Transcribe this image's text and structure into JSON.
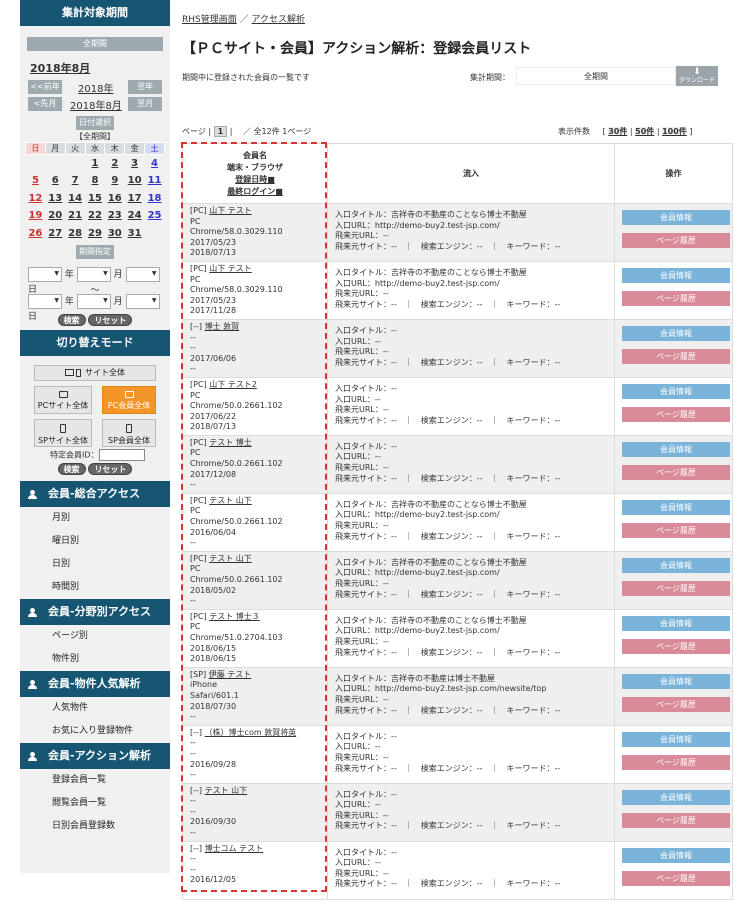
{
  "sidebar": {
    "period_title": "集計対象期間",
    "all_period": "全期間",
    "year_month": "2018年8月",
    "prev_year": "<<前年",
    "year": "2018年",
    "next_year": "翌年",
    "prev_month": "<先月",
    "month": "2018年8月",
    "next_month": "翌月",
    "date_select": "日付選択",
    "all_period_note": "【全期間】",
    "weekdays": [
      "日",
      "月",
      "火",
      "水",
      "木",
      "金",
      "土"
    ],
    "weeks": [
      [
        "",
        "",
        "",
        "1",
        "2",
        "3",
        "4"
      ],
      [
        "5",
        "6",
        "7",
        "8",
        "9",
        "10",
        "11"
      ],
      [
        "12",
        "13",
        "14",
        "15",
        "16",
        "17",
        "18"
      ],
      [
        "19",
        "20",
        "21",
        "22",
        "23",
        "24",
        "25"
      ],
      [
        "26",
        "27",
        "28",
        "29",
        "30",
        "31",
        ""
      ]
    ],
    "range_title": "期間指定",
    "year_label": "年",
    "month_label": "月",
    "day_label": "日",
    "tilde": "～",
    "search": "検索",
    "reset": "リセット",
    "mode_title": "切り替えモード",
    "site_all": "サイト全体",
    "pc_site_all": "PCサイト全体",
    "pc_member_all": "PC会員全体",
    "sp_site_all": "SPサイト全体",
    "sp_member_all": "SP会員全体",
    "member_id_label": "特定会員ID：",
    "categories": [
      {
        "title": "会員-総合アクセス",
        "items": [
          "月別",
          "曜日別",
          "日別",
          "時間別"
        ]
      },
      {
        "title": "会員-分野別アクセス",
        "items": [
          "ページ別",
          "物件別"
        ]
      },
      {
        "title": "会員-物件人気解析",
        "items": [
          "人気物件",
          "お気に入り登録物件"
        ]
      },
      {
        "title": "会員-アクション解析",
        "items": [
          "登録会員一覧",
          "閲覧会員一覧",
          "日別会員登録数"
        ]
      }
    ]
  },
  "header": {
    "breadcrumb_home": "RHS管理画面",
    "breadcrumb_sep": "／",
    "breadcrumb_current": "アクセス解析",
    "title": "【ＰＣサイト・会員】アクション解析：登録会員リスト",
    "description": "期間中に登録された会員の一覧です",
    "period_label": "集計期間：",
    "period_value": "全期間",
    "download": "ダウンロード"
  },
  "pager": {
    "page_label": "ページ",
    "sep": "|",
    "current": "1",
    "slash": "／",
    "total": "全12件 1ページ",
    "per_page_label": "表示件数",
    "bracket_open": "[",
    "bracket_close": "]",
    "opt30": "30件",
    "opt50": "50件",
    "opt100": "100件"
  },
  "table": {
    "col_member": [
      "会員名",
      "端末・ブラウザ"
    ],
    "col_member_links": [
      "登録日時■",
      "最終ログイン■"
    ],
    "col_entry": "流入",
    "col_actions": "操作",
    "btn_info": "会員情報",
    "btn_history": "ページ履歴",
    "rows": [
      {
        "prefix": "[PC]",
        "name": "山下 テスト",
        "device": "PC",
        "browser": "Chrome/58.0.3029.110",
        "registered": "2017/05/23",
        "last_login": "2018/07/13",
        "entry": [
          "入口タイトル：吉祥寺の不動産のことなら博士不動屋",
          "入口URL：http://demo-buy2.test-jsp.com/",
          "飛来元URL：--",
          "飛来元サイト：--　｜　検索エンジン：--　｜　キーワード：--"
        ]
      },
      {
        "prefix": "[PC]",
        "name": "山下 テスト",
        "device": "PC",
        "browser": "Chrome/58.0.3029.110",
        "registered": "2017/05/23",
        "last_login": "2017/11/28",
        "entry": [
          "入口タイトル：吉祥寺の不動産のことなら博士不動屋",
          "入口URL：http://demo-buy2.test-jsp.com/",
          "飛来元URL：--",
          "飛来元サイト：--　｜　検索エンジン：--　｜　キーワード：--"
        ]
      },
      {
        "prefix": "[--]",
        "name": "博士 敦賀",
        "device": "--",
        "browser": "--",
        "registered": "2017/06/06",
        "last_login": "--",
        "entry": [
          "入口タイトル：--",
          "入口URL：--",
          "飛来元URL：--",
          "飛来元サイト：--　｜　検索エンジン：--　｜　キーワード：--"
        ]
      },
      {
        "prefix": "[PC]",
        "name": "山下 テスト2",
        "device": "PC",
        "browser": "Chrome/50.0.2661.102",
        "registered": "2017/06/22",
        "last_login": "2018/07/13",
        "entry": [
          "入口タイトル：--",
          "入口URL：--",
          "飛来元URL：--",
          "飛来元サイト：--　｜　検索エンジン：--　｜　キーワード：--"
        ]
      },
      {
        "prefix": "[PC]",
        "name": "テスト 博士",
        "device": "PC",
        "browser": "Chrome/50.0.2661.102",
        "registered": "2017/12/08",
        "last_login": "--",
        "entry": [
          "入口タイトル：--",
          "入口URL：--",
          "飛来元URL：--",
          "飛来元サイト：--　｜　検索エンジン：--　｜　キーワード：--"
        ]
      },
      {
        "prefix": "[PC]",
        "name": "テスト 山下",
        "device": "PC",
        "browser": "Chrome/50.0.2661.102",
        "registered": "2016/06/04",
        "last_login": "--",
        "entry": [
          "入口タイトル：吉祥寺の不動産のことなら博士不動屋",
          "入口URL：http://demo-buy2.test-jsp.com/",
          "飛来元URL：--",
          "飛来元サイト：--　｜　検索エンジン：--　｜　キーワード：--"
        ]
      },
      {
        "prefix": "[PC]",
        "name": "テスト 山下",
        "device": "PC",
        "browser": "Chrome/50.0.2661.102",
        "registered": "2018/05/02",
        "last_login": "--",
        "entry": [
          "入口タイトル：吉祥寺の不動産のことなら博士不動屋",
          "入口URL：http://demo-buy2.test-jsp.com/",
          "飛来元URL：--",
          "飛来元サイト：--　｜　検索エンジン：--　｜　キーワード：--"
        ]
      },
      {
        "prefix": "[PC]",
        "name": "テスト 博士３",
        "device": "PC",
        "browser": "Chrome/51.0.2704.103",
        "registered": "2018/06/15",
        "last_login": "2018/06/15",
        "entry": [
          "入口タイトル：吉祥寺の不動産のことなら博士不動屋",
          "入口URL：http://demo-buy2.test-jsp.com/",
          "飛来元URL：--",
          "飛来元サイト：--　｜　検索エンジン：--　｜　キーワード：--"
        ]
      },
      {
        "prefix": "[SP]",
        "name": "伊藤 テスト",
        "device": "iPhone",
        "browser": "Safari/601.1",
        "registered": "2018/07/30",
        "last_login": "--",
        "entry": [
          "入口タイトル：吉祥寺の不動産は博士不動屋",
          "入口URL：http://demo-buy2.test-jsp.com/newsite/top",
          "飛来元URL：--",
          "飛来元サイト：--　｜　検索エンジン：--　｜　キーワード：--"
        ]
      },
      {
        "prefix": "[--]",
        "name": "（株）博士com 敦賀将英",
        "device": "--",
        "browser": "--",
        "registered": "2016/09/28",
        "last_login": "--",
        "entry": [
          "入口タイトル：--",
          "入口URL：--",
          "飛来元URL：--",
          "飛来元サイト：--　｜　検索エンジン：--　｜　キーワード：--"
        ]
      },
      {
        "prefix": "[--]",
        "name": "テスト 山下",
        "device": "--",
        "browser": "--",
        "registered": "2016/09/30",
        "last_login": "--",
        "entry": [
          "入口タイトル：--",
          "入口URL：--",
          "飛来元URL：--",
          "飛来元サイト：--　｜　検索エンジン：--　｜　キーワード：--"
        ]
      },
      {
        "prefix": "[--]",
        "name": "博士コム テスト",
        "device": "--",
        "browser": "--",
        "registered": "2016/12/05",
        "last_login": "--",
        "entry": [
          "入口タイトル：--",
          "入口URL：--",
          "飛来元URL：--",
          "飛来元サイト：--　｜　検索エンジン：--　｜　キーワード：--"
        ]
      }
    ]
  },
  "colors": {
    "navy": "#175673",
    "orange": "#f29727",
    "info": "#7ab4da",
    "history": "#d98a98",
    "highlight": "#d63333"
  }
}
